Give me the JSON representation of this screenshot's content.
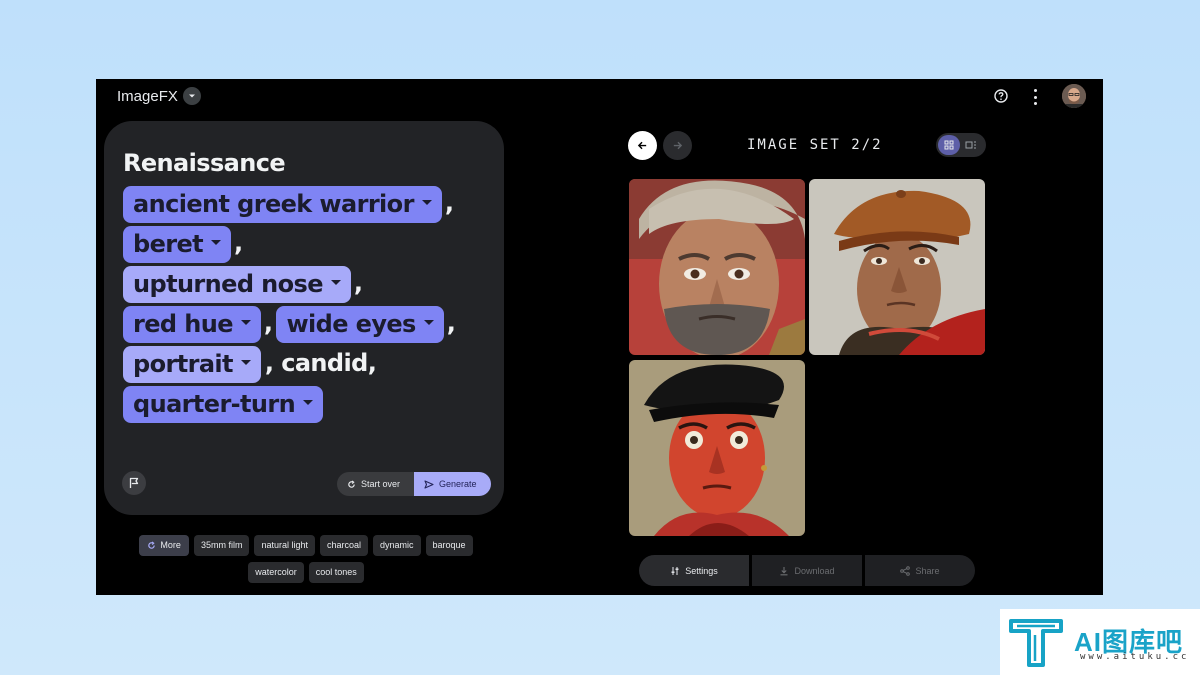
{
  "header": {
    "app_title": "ImageFX",
    "icons": [
      "chevron-down-icon",
      "help-icon",
      "more-vert-icon",
      "avatar"
    ]
  },
  "prompt": {
    "lead": "Renaissance",
    "chip_ancient": "ancient greek warrior",
    "chip_beret": "beret",
    "chip_upturned": "upturned nose",
    "chip_red": "red hue",
    "chip_wide": "wide eyes",
    "chip_portrait": "portrait",
    "chip_quarter": "quarter-turn",
    "comma": ",",
    "candid": ", candid,"
  },
  "card_buttons": {
    "start_over": "Start over",
    "generate": "Generate"
  },
  "suggestions": {
    "more": "More",
    "items": [
      "35mm film",
      "natural light",
      "charcoal",
      "dynamic",
      "baroque",
      "watercolor",
      "cool tones"
    ]
  },
  "viewer": {
    "set_label": "IMAGE SET 2/2"
  },
  "actions": {
    "settings": "Settings",
    "download": "Download",
    "share": "Share"
  },
  "watermark": {
    "name": "AI图库吧",
    "url": "www.aituku.cc"
  },
  "colors": {
    "chip": "#7f84f4",
    "chip_light": "#a7aaf9",
    "card_bg": "#222326",
    "generate_bg": "#a8abf8"
  }
}
